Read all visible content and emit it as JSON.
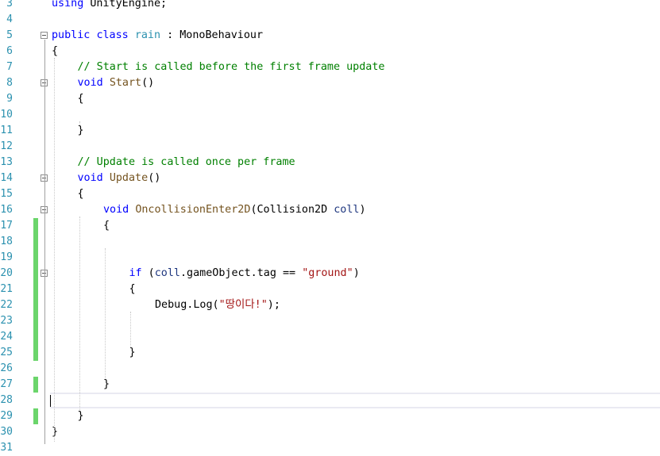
{
  "editor": {
    "lines": [
      {
        "n": "3",
        "indent": 0,
        "fold": false,
        "changed": false,
        "tokens": [
          {
            "t": "using",
            "c": "kw"
          },
          {
            "t": " UnityEngine;",
            "c": ""
          }
        ]
      },
      {
        "n": "4",
        "indent": 0,
        "fold": false,
        "changed": false,
        "tokens": []
      },
      {
        "n": "5",
        "indent": 0,
        "fold": true,
        "changed": false,
        "tokens": [
          {
            "t": "public",
            "c": "kw"
          },
          {
            "t": " ",
            "c": ""
          },
          {
            "t": "class",
            "c": "kw"
          },
          {
            "t": " ",
            "c": ""
          },
          {
            "t": "rain",
            "c": "cls"
          },
          {
            "t": " : MonoBehaviour",
            "c": ""
          }
        ]
      },
      {
        "n": "6",
        "indent": 0,
        "fold": false,
        "changed": false,
        "tokens": [
          {
            "t": "{",
            "c": ""
          }
        ]
      },
      {
        "n": "7",
        "indent": 1,
        "fold": false,
        "changed": false,
        "tokens": [
          {
            "t": "// Start is called before the first frame update",
            "c": "cmt"
          }
        ]
      },
      {
        "n": "8",
        "indent": 1,
        "fold": true,
        "changed": false,
        "tokens": [
          {
            "t": "void",
            "c": "kw"
          },
          {
            "t": " ",
            "c": ""
          },
          {
            "t": "Start",
            "c": "mth"
          },
          {
            "t": "()",
            "c": ""
          }
        ]
      },
      {
        "n": "9",
        "indent": 1,
        "fold": false,
        "changed": false,
        "tokens": [
          {
            "t": "{",
            "c": ""
          }
        ]
      },
      {
        "n": "10",
        "indent": 1,
        "fold": false,
        "changed": false,
        "tokens": []
      },
      {
        "n": "11",
        "indent": 1,
        "fold": false,
        "changed": false,
        "tokens": [
          {
            "t": "}",
            "c": ""
          }
        ]
      },
      {
        "n": "12",
        "indent": 0,
        "fold": false,
        "changed": false,
        "tokens": []
      },
      {
        "n": "13",
        "indent": 1,
        "fold": false,
        "changed": false,
        "tokens": [
          {
            "t": "// Update is called once per frame",
            "c": "cmt"
          }
        ]
      },
      {
        "n": "14",
        "indent": 1,
        "fold": true,
        "changed": false,
        "tokens": [
          {
            "t": "void",
            "c": "kw"
          },
          {
            "t": " ",
            "c": ""
          },
          {
            "t": "Update",
            "c": "mth"
          },
          {
            "t": "()",
            "c": ""
          }
        ]
      },
      {
        "n": "15",
        "indent": 1,
        "fold": false,
        "changed": false,
        "tokens": [
          {
            "t": "{",
            "c": ""
          }
        ]
      },
      {
        "n": "16",
        "indent": 2,
        "fold": true,
        "changed": false,
        "tokens": [
          {
            "t": "void",
            "c": "kw"
          },
          {
            "t": " ",
            "c": ""
          },
          {
            "t": "OncollisionEnter2D",
            "c": "mth"
          },
          {
            "t": "(Collision2D ",
            "c": ""
          },
          {
            "t": "coll",
            "c": "prm"
          },
          {
            "t": ")",
            "c": ""
          }
        ]
      },
      {
        "n": "17",
        "indent": 2,
        "fold": false,
        "changed": true,
        "tokens": [
          {
            "t": "{",
            "c": ""
          }
        ]
      },
      {
        "n": "18",
        "indent": 0,
        "fold": false,
        "changed": true,
        "tokens": []
      },
      {
        "n": "19",
        "indent": 0,
        "fold": false,
        "changed": true,
        "tokens": []
      },
      {
        "n": "20",
        "indent": 3,
        "fold": true,
        "changed": true,
        "tokens": [
          {
            "t": "if",
            "c": "kw"
          },
          {
            "t": " (",
            "c": ""
          },
          {
            "t": "coll",
            "c": "prm"
          },
          {
            "t": ".gameObject.tag == ",
            "c": ""
          },
          {
            "t": "\"ground\"",
            "c": "str"
          },
          {
            "t": ")",
            "c": ""
          }
        ]
      },
      {
        "n": "21",
        "indent": 3,
        "fold": false,
        "changed": true,
        "tokens": [
          {
            "t": "{",
            "c": ""
          }
        ]
      },
      {
        "n": "22",
        "indent": 4,
        "fold": false,
        "changed": true,
        "tokens": [
          {
            "t": "Debug.Log(",
            "c": ""
          },
          {
            "t": "\"땅이다!\"",
            "c": "str"
          },
          {
            "t": ");",
            "c": ""
          }
        ]
      },
      {
        "n": "23",
        "indent": 0,
        "fold": false,
        "changed": true,
        "tokens": []
      },
      {
        "n": "24",
        "indent": 0,
        "fold": false,
        "changed": true,
        "tokens": []
      },
      {
        "n": "25",
        "indent": 3,
        "fold": false,
        "changed": true,
        "tokens": [
          {
            "t": "}",
            "c": ""
          }
        ]
      },
      {
        "n": "26",
        "indent": 0,
        "fold": false,
        "changed": false,
        "tokens": []
      },
      {
        "n": "27",
        "indent": 2,
        "fold": false,
        "changed": true,
        "tokens": [
          {
            "t": "}",
            "c": ""
          }
        ]
      },
      {
        "n": "28",
        "indent": 0,
        "fold": false,
        "changed": false,
        "tokens": []
      },
      {
        "n": "29",
        "indent": 1,
        "fold": false,
        "changed": true,
        "tokens": [
          {
            "t": "}",
            "c": ""
          }
        ]
      },
      {
        "n": "30",
        "indent": 0,
        "fold": false,
        "changed": false,
        "tokens": [
          {
            "t": "}",
            "c": ""
          }
        ]
      },
      {
        "n": "31",
        "indent": 0,
        "fold": false,
        "changed": false,
        "tokens": []
      }
    ]
  },
  "colors": {
    "line_number": "#2b91af",
    "keyword": "#0000ff",
    "type": "#2b91af",
    "comment": "#008000",
    "string": "#a31515",
    "method": "#74531f",
    "parameter": "#1f377f",
    "change_bar": "#6bd56b"
  }
}
